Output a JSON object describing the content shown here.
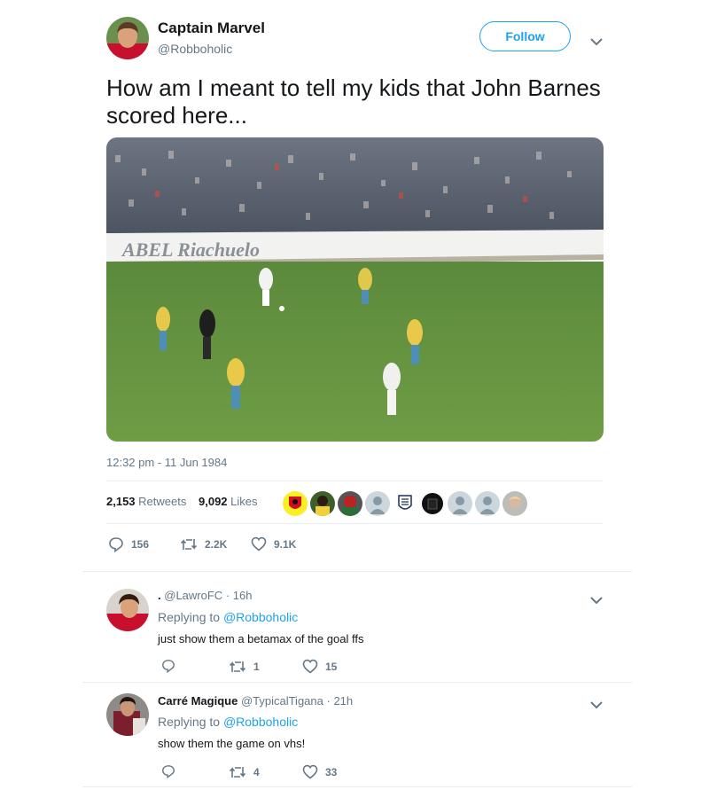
{
  "tweet": {
    "author_name": "Captain Marvel",
    "author_handle": "@Robboholic",
    "follow_label": "Follow",
    "text": "How am I meant to tell my kids that John Barnes scored here...",
    "media_banner_text": "ABEL  Riachuelo",
    "timestamp": "12:32 pm - 11 Jun 1984",
    "retweets_count": "2,153",
    "retweets_label": "Retweets",
    "likes_count": "9,092",
    "likes_label": "Likes",
    "actions": {
      "replies": "156",
      "retweets": "2.2K",
      "likes": "9.1K"
    }
  },
  "replies": [
    {
      "name": ".",
      "handle": "@LawroFC",
      "time": "· 16h",
      "replying_prefix": "Replying to",
      "replying_to": "@Robboholic",
      "text": "just show them a betamax of the goal ffs",
      "actions": {
        "replies": "",
        "retweets": "1",
        "likes": "15"
      }
    },
    {
      "name": "Carré Magique",
      "handle": "@TypicalTigana",
      "time": "· 21h",
      "replying_prefix": "Replying to",
      "replying_to": "@Robboholic",
      "text": "show them the game on vhs!",
      "actions": {
        "replies": "",
        "retweets": "4",
        "likes": "33"
      }
    }
  ],
  "colors": {
    "accent": "#1da1f2",
    "secondary_text": "#657786",
    "divider": "#e6ecf0"
  }
}
